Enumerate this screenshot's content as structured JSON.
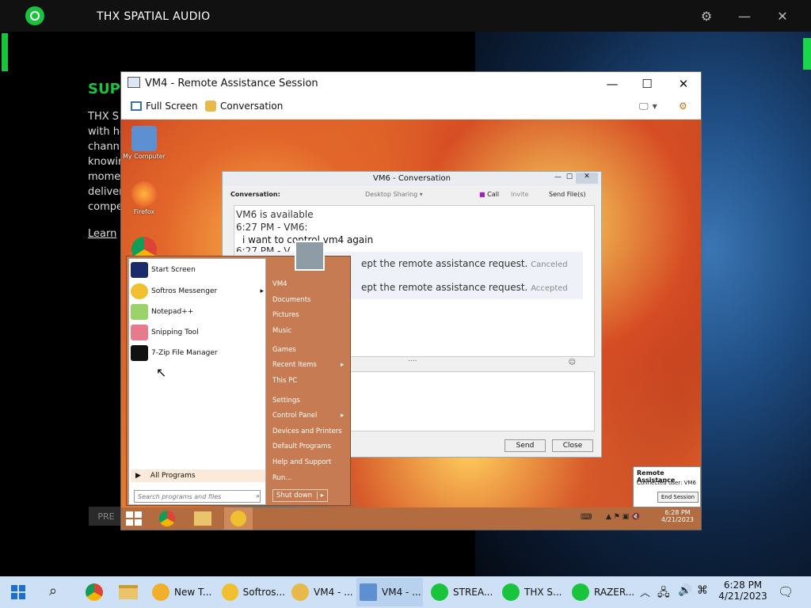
{
  "thx": {
    "title": "THX SPATIAL AUDIO",
    "heading": "SUPE",
    "body": [
      "THX S",
      "with he",
      "chann",
      "knowin",
      "mome",
      "deliver",
      "compe"
    ],
    "learn": "Learn",
    "prev": "PRE"
  },
  "ra": {
    "title": "VM4 - Remote Assistance Session",
    "fullscreen": "Full Screen",
    "conversation": "Conversation"
  },
  "desktop": {
    "icons": [
      "My Computer",
      "Firefox"
    ]
  },
  "conv": {
    "title": "VM6 - Conversation",
    "label": "Conversation:",
    "desktop_sharing": "Desktop Sharing",
    "call": "Call",
    "invite": "Invite",
    "send_files": "Send File(s)",
    "history": {
      "l1": "VM6 is available",
      "l2": "6:27 PM - VM6:",
      "l3": "i want to control vm4 again",
      "l4": "6:27 PM - V",
      "s1": "ept the remote assistance request.",
      "s1_status": "Canceled",
      "s2": "ept the remote assistance request.",
      "s2_status": "Accepted"
    },
    "separator": "....",
    "send": "Send",
    "close": "Close"
  },
  "startmenu": {
    "programs": [
      "Start Screen",
      "Softros Messenger",
      "Notepad++",
      "Snipping Tool",
      "7-Zip File Manager"
    ],
    "all_programs": "All Programs",
    "search_placeholder": "Search programs and files",
    "right": [
      "VM4",
      "Documents",
      "Pictures",
      "Music",
      "Games",
      "Recent Items",
      "This PC",
      "Settings",
      "Control Panel",
      "Devices and Printers",
      "Default Programs",
      "Help and Support",
      "Run..."
    ],
    "shutdown": "Shut down"
  },
  "inner_clock": {
    "time": "6:28 PM",
    "date": "4/21/2023"
  },
  "ra_notice": {
    "title": "Remote Assistance",
    "user": "Connected user:  VM6",
    "end": "End Session"
  },
  "taskbar": {
    "items": [
      "New T...",
      "Softros...",
      "VM4 - ...",
      "VM4 - ...",
      "STREA...",
      "THX S...",
      "RAZER..."
    ],
    "time": "6:28 PM",
    "date": "4/21/2023"
  }
}
